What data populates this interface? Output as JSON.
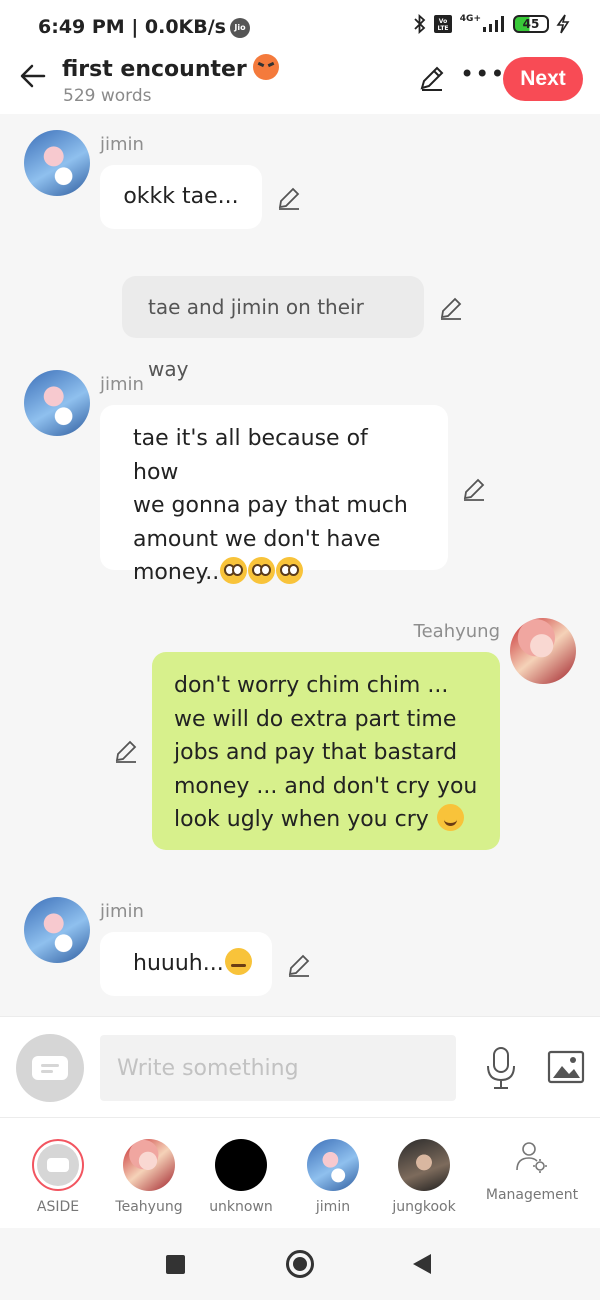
{
  "status_bar": {
    "time": "6:49 PM | 0.0KB/s",
    "carrier_badge": "Jio",
    "network": "4G+",
    "battery": "45"
  },
  "header": {
    "title": "first encounter",
    "title_emoji": "angry-face",
    "word_count": "529 words",
    "next_label": "Next"
  },
  "messages": [
    {
      "type": "character",
      "side": "left",
      "speaker": "jimin",
      "text": "okkk tae..."
    },
    {
      "type": "aside",
      "text": "tae and jimin on their way"
    },
    {
      "type": "character",
      "side": "left",
      "speaker": "jimin",
      "lines": [
        "tae it's all because of how",
        "we gonna pay that much",
        "amount we don't have",
        "money.."
      ],
      "emoji": "flushed-face x3"
    },
    {
      "type": "character",
      "side": "right",
      "speaker": "Teahyung",
      "lines": [
        "don't worry chim chim ...",
        "we will do extra part time",
        "jobs and pay that bastard",
        "money ... and don't cry you",
        "look ugly when you cry"
      ],
      "emoji": "smiling-face"
    },
    {
      "type": "character",
      "side": "left",
      "speaker": "jimin",
      "text": "huuuh...",
      "emoji": "pensive-face"
    }
  ],
  "composer": {
    "placeholder": "Write something"
  },
  "characters": [
    {
      "label": "ASIDE",
      "selected": true
    },
    {
      "label": "Teahyung"
    },
    {
      "label": "unknown"
    },
    {
      "label": "jimin"
    },
    {
      "label": "jungkook"
    }
  ],
  "management_label": "Management",
  "colors": {
    "accent": "#f84b55",
    "my_bubble": "#d7f08c",
    "other_bubble": "#ffffff",
    "aside_bubble": "#ebebeb",
    "background": "#f6f6f6"
  }
}
